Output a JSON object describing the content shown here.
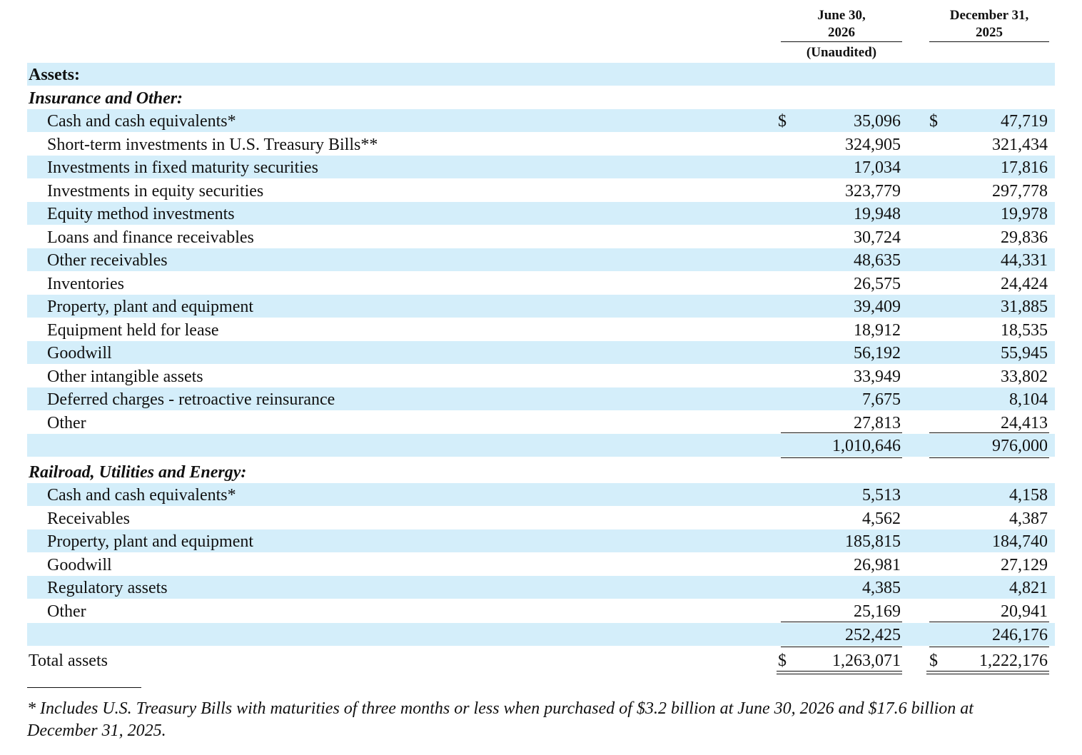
{
  "header": {
    "col1_line1": "June 30,",
    "col1_line2": "2026",
    "col1_note": "(Unaudited)",
    "col2_line1": "December 31,",
    "col2_line2": "2025"
  },
  "assets_label": "Assets:",
  "insurance": {
    "title": "Insurance and Other:",
    "rows": [
      {
        "label": "Cash and cash equivalents*",
        "dollar1": "$",
        "v1": "35,096",
        "dollar2": "$",
        "v2": "47,719"
      },
      {
        "label": "Short-term investments in U.S. Treasury Bills**",
        "v1": "324,905",
        "v2": "321,434"
      },
      {
        "label": "Investments in fixed maturity securities",
        "v1": "17,034",
        "v2": "17,816"
      },
      {
        "label": "Investments in equity securities",
        "v1": "323,779",
        "v2": "297,778"
      },
      {
        "label": "Equity method investments",
        "v1": "19,948",
        "v2": "19,978"
      },
      {
        "label": "Loans and finance receivables",
        "v1": "30,724",
        "v2": "29,836"
      },
      {
        "label": "Other receivables",
        "v1": "48,635",
        "v2": "44,331"
      },
      {
        "label": "Inventories",
        "v1": "26,575",
        "v2": "24,424"
      },
      {
        "label": "Property, plant and equipment",
        "v1": "39,409",
        "v2": "31,885"
      },
      {
        "label": "Equipment held for lease",
        "v1": "18,912",
        "v2": "18,535"
      },
      {
        "label": "Goodwill",
        "v1": "56,192",
        "v2": "55,945"
      },
      {
        "label": "Other intangible assets",
        "v1": "33,949",
        "v2": "33,802"
      },
      {
        "label": "Deferred charges - retroactive reinsurance",
        "v1": "7,675",
        "v2": "8,104"
      },
      {
        "label": "Other",
        "v1": "27,813",
        "v2": "24,413"
      }
    ],
    "subtotal": {
      "v1": "1,010,646",
      "v2": "976,000"
    }
  },
  "railroad": {
    "title": "Railroad, Utilities and Energy:",
    "rows": [
      {
        "label": "Cash and cash equivalents*",
        "v1": "5,513",
        "v2": "4,158"
      },
      {
        "label": "Receivables",
        "v1": "4,562",
        "v2": "4,387"
      },
      {
        "label": "Property, plant and equipment",
        "v1": "185,815",
        "v2": "184,740"
      },
      {
        "label": "Goodwill",
        "v1": "26,981",
        "v2": "27,129"
      },
      {
        "label": "Regulatory assets",
        "v1": "4,385",
        "v2": "4,821"
      },
      {
        "label": "Other",
        "v1": "25,169",
        "v2": "20,941"
      }
    ],
    "subtotal": {
      "v1": "252,425",
      "v2": "246,176"
    }
  },
  "total": {
    "label": "Total assets",
    "dollar1": "$",
    "v1": "1,263,071",
    "dollar2": "$",
    "v2": "1,222,176"
  },
  "footnote": "* Includes U.S. Treasury Bills with maturities of three months or less when purchased of $3.2 billion at June 30, 2026 and $17.6 billion at December 31, 2025.",
  "colors": {
    "row_band": "#d4eefa",
    "text": "#111111"
  }
}
